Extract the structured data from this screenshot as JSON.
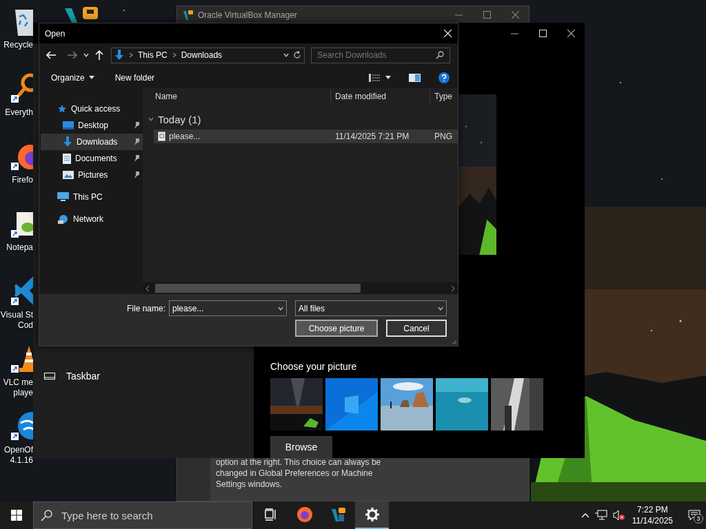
{
  "desktop": {
    "icons": [
      {
        "kind": "recycle",
        "label": "Recycle"
      },
      {
        "kind": "everything",
        "label": "Everyth"
      },
      {
        "kind": "firefox",
        "label": "Firefo"
      },
      {
        "kind": "notepad",
        "label": "Notepa"
      },
      {
        "kind": "vscode",
        "label": "Visual St\nCod"
      },
      {
        "kind": "vlc",
        "label": "VLC me\nplaye"
      },
      {
        "kind": "openoffice",
        "label": "OpenOf\n4.1.16"
      }
    ]
  },
  "virtualbox_window": {
    "title": "Oracle VirtualBox Manager",
    "text": "option at the right. This choice can always be changed in Global Preferences or Machine Settings windows."
  },
  "settings_window": {
    "nav_items": [
      {
        "label": "Taskbar"
      }
    ],
    "picture_section": {
      "title": "Choose your picture",
      "thumbnails": [
        {
          "kind": "night"
        },
        {
          "kind": "windows"
        },
        {
          "kind": "beach"
        },
        {
          "kind": "underwater"
        },
        {
          "kind": "rock"
        }
      ],
      "browse_button": "Browse"
    }
  },
  "open_dialog": {
    "title": "Open",
    "forward_disabled": true,
    "breadcrumb": [
      "This PC",
      "Downloads"
    ],
    "search": {
      "placeholder": "Search Downloads"
    },
    "toolbar": [
      "Organize",
      "New folder"
    ],
    "nav_tree": [
      {
        "kind": "star",
        "label": "Quick access",
        "selected": false,
        "children": [
          {
            "kind": "desktop",
            "label": "Desktop",
            "selected": false,
            "pinned": true
          },
          {
            "kind": "downloads",
            "label": "Downloads",
            "selected": true,
            "pinned": true
          },
          {
            "kind": "documents",
            "label": "Documents",
            "selected": false,
            "pinned": true
          },
          {
            "kind": "pictures",
            "label": "Pictures",
            "selected": false,
            "pinned": true
          }
        ]
      },
      {
        "kind": "pc",
        "label": "This PC",
        "selected": false
      },
      {
        "kind": "network",
        "label": "Network",
        "selected": false
      }
    ],
    "columns": [
      "Name",
      "Date modified",
      "Type"
    ],
    "groups": [
      {
        "label": "Today (1)",
        "files": [
          {
            "name": "please...",
            "date": "11/14/2025 7:21 PM",
            "type": "PNG",
            "selected": true
          }
        ]
      }
    ],
    "file_name": {
      "label": "File name:",
      "value": "please..."
    },
    "filter": "All files",
    "buttons": [
      "Choose picture",
      "Cancel"
    ]
  },
  "taskbar": {
    "search": {
      "placeholder": "Type here to search"
    },
    "apps": [
      {
        "kind": "task-view",
        "selected": false
      },
      {
        "kind": "firefox",
        "selected": false
      },
      {
        "kind": "virtualbox",
        "selected": false
      },
      {
        "kind": "settings",
        "selected": true
      }
    ],
    "time": "7:22 PM",
    "date": "11/14/2025",
    "notifications": "3"
  }
}
